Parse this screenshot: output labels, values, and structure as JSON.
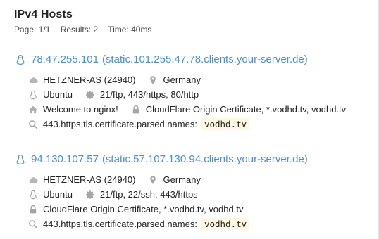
{
  "header": {
    "title": "IPv4 Hosts",
    "page": "Page: 1/1",
    "results": "Results: 2",
    "time": "Time: 40ms"
  },
  "hosts": [
    {
      "ip": "78.47.255.101",
      "rdns": "(static.101.255.47.78.clients.your-server.de)",
      "as": "HETZNER-AS (24940)",
      "country": "Germany",
      "os": "Ubuntu",
      "services": "21/ftp, 443/https, 80/http",
      "http_title": "Welcome to nginx!",
      "certificate": "CloudFlare Origin Certificate, *.vodhd.tv, vodhd.tv",
      "match_field": "443.https.tls.certificate.parsed.names:",
      "match_value": "vodhd.tv"
    },
    {
      "ip": "94.130.107.57",
      "rdns": "(static.57.107.130.94.clients.your-server.de)",
      "as": "HETZNER-AS (24940)",
      "country": "Germany",
      "os": "Ubuntu",
      "services": "21/ftp, 22/ssh, 443/https",
      "certificate": "CloudFlare Origin Certificate, *.vodhd.tv, vodhd.tv",
      "match_field": "443.https.tls.certificate.parsed.names:",
      "match_value": "vodhd.tv"
    }
  ],
  "colors": {
    "link": "#4a90d9",
    "icon": "#9a9a9a",
    "highlight": "#fdf8e1"
  },
  "icons": [
    "linux-icon",
    "cloud-icon",
    "map-pin-icon",
    "gear-icon",
    "home-icon",
    "lock-icon",
    "search-icon"
  ]
}
